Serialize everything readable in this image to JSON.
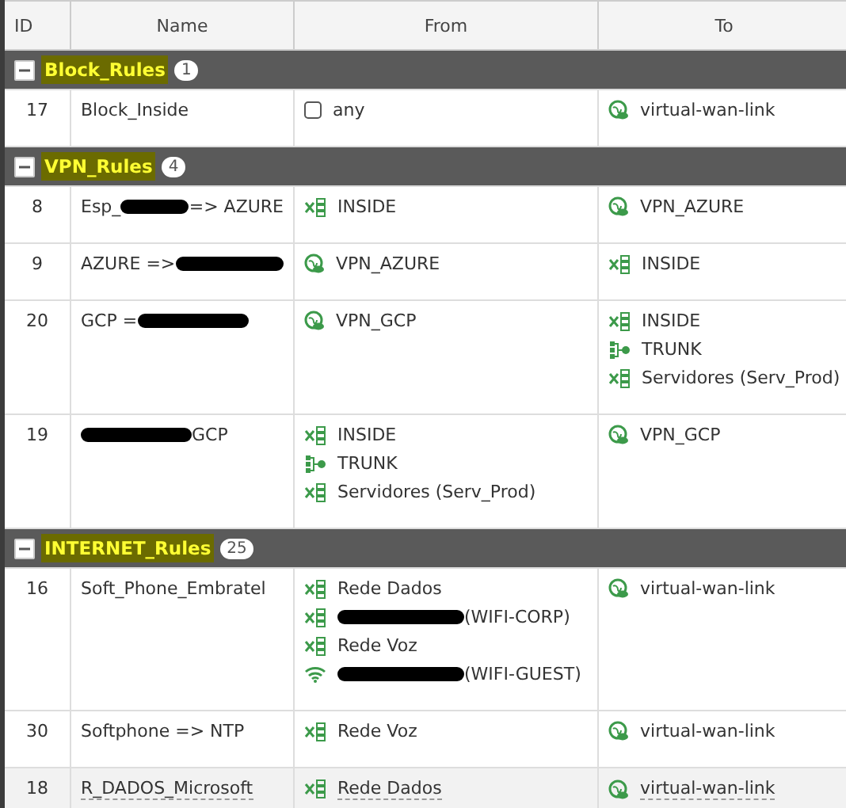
{
  "table": {
    "columns": [
      "ID",
      "Name",
      "From",
      "To"
    ],
    "groups": [
      {
        "label": "Block_Rules",
        "count": "1",
        "expanded": true,
        "rows": [
          {
            "id": "17",
            "selected": false,
            "name": [
              {
                "kind": "text",
                "text": "Block_Inside"
              }
            ],
            "from": [
              {
                "kind": "any",
                "parts": [
                  {
                    "kind": "text",
                    "text": "any"
                  }
                ]
              }
            ],
            "to": [
              {
                "kind": "vpn",
                "parts": [
                  {
                    "kind": "text",
                    "text": "virtual-wan-link"
                  }
                ]
              }
            ]
          }
        ]
      },
      {
        "label": "VPN_Rules",
        "count": "4",
        "expanded": true,
        "rows": [
          {
            "id": "8",
            "selected": false,
            "name": [
              {
                "kind": "text",
                "text": "Esp_"
              },
              {
                "kind": "redaction"
              },
              {
                "kind": "text",
                "text": "=> AZURE"
              }
            ],
            "from": [
              {
                "kind": "interface",
                "parts": [
                  {
                    "kind": "text",
                    "text": "INSIDE"
                  }
                ]
              }
            ],
            "to": [
              {
                "kind": "vpn",
                "parts": [
                  {
                    "kind": "text",
                    "text": "VPN_AZURE"
                  }
                ]
              }
            ]
          },
          {
            "id": "9",
            "selected": false,
            "name": [
              {
                "kind": "text",
                "text": "AZURE =>"
              },
              {
                "kind": "redaction"
              }
            ],
            "from": [
              {
                "kind": "vpn",
                "parts": [
                  {
                    "kind": "text",
                    "text": "VPN_AZURE"
                  }
                ]
              }
            ],
            "to": [
              {
                "kind": "interface",
                "parts": [
                  {
                    "kind": "text",
                    "text": "INSIDE"
                  }
                ]
              }
            ]
          },
          {
            "id": "20",
            "selected": false,
            "name": [
              {
                "kind": "text",
                "text": "GCP ="
              },
              {
                "kind": "redaction"
              }
            ],
            "from": [
              {
                "kind": "vpn",
                "parts": [
                  {
                    "kind": "text",
                    "text": "VPN_GCP"
                  }
                ]
              }
            ],
            "to": [
              {
                "kind": "interface",
                "parts": [
                  {
                    "kind": "text",
                    "text": "INSIDE"
                  }
                ]
              },
              {
                "kind": "trunk",
                "parts": [
                  {
                    "kind": "text",
                    "text": "TRUNK"
                  }
                ]
              },
              {
                "kind": "interface",
                "parts": [
                  {
                    "kind": "text",
                    "text": "Servidores (Serv_Prod)"
                  }
                ]
              }
            ]
          },
          {
            "id": "19",
            "selected": false,
            "name": [
              {
                "kind": "redaction"
              },
              {
                "kind": "text",
                "text": "GCP"
              }
            ],
            "from": [
              {
                "kind": "interface",
                "parts": [
                  {
                    "kind": "text",
                    "text": "INSIDE"
                  }
                ]
              },
              {
                "kind": "trunk",
                "parts": [
                  {
                    "kind": "text",
                    "text": "TRUNK"
                  }
                ]
              },
              {
                "kind": "interface",
                "parts": [
                  {
                    "kind": "text",
                    "text": "Servidores (Serv_Prod)"
                  }
                ]
              }
            ],
            "to": [
              {
                "kind": "vpn",
                "parts": [
                  {
                    "kind": "text",
                    "text": "VPN_GCP"
                  }
                ]
              }
            ]
          }
        ]
      },
      {
        "label": "INTERNET_Rules",
        "count": "25",
        "expanded": true,
        "rows": [
          {
            "id": "16",
            "selected": false,
            "name": [
              {
                "kind": "text",
                "text": "Soft_Phone_Embratel"
              }
            ],
            "from": [
              {
                "kind": "interface",
                "parts": [
                  {
                    "kind": "text",
                    "text": "Rede Dados"
                  }
                ]
              },
              {
                "kind": "interface",
                "parts": [
                  {
                    "kind": "redaction"
                  },
                  {
                    "kind": "text",
                    "text": "(WIFI-CORP)"
                  }
                ]
              },
              {
                "kind": "interface",
                "parts": [
                  {
                    "kind": "text",
                    "text": "Rede Voz"
                  }
                ]
              },
              {
                "kind": "wifi",
                "parts": [
                  {
                    "kind": "redaction"
                  },
                  {
                    "kind": "text",
                    "text": "(WIFI-GUEST)"
                  }
                ]
              }
            ],
            "to": [
              {
                "kind": "vpn",
                "parts": [
                  {
                    "kind": "text",
                    "text": "virtual-wan-link"
                  }
                ]
              }
            ]
          },
          {
            "id": "30",
            "selected": false,
            "name": [
              {
                "kind": "text",
                "text": "Softphone => NTP"
              }
            ],
            "from": [
              {
                "kind": "interface",
                "parts": [
                  {
                    "kind": "text",
                    "text": "Rede Voz"
                  }
                ]
              }
            ],
            "to": [
              {
                "kind": "vpn",
                "parts": [
                  {
                    "kind": "text",
                    "text": "virtual-wan-link"
                  }
                ]
              }
            ]
          },
          {
            "id": "18",
            "selected": true,
            "name": [
              {
                "kind": "text",
                "text": "R_DADOS_Microsoft"
              }
            ],
            "from": [
              {
                "kind": "interface",
                "parts": [
                  {
                    "kind": "text",
                    "text": "Rede Dados"
                  }
                ]
              }
            ],
            "to": [
              {
                "kind": "vpn",
                "parts": [
                  {
                    "kind": "text",
                    "text": "virtual-wan-link"
                  }
                ]
              }
            ]
          }
        ]
      }
    ]
  }
}
